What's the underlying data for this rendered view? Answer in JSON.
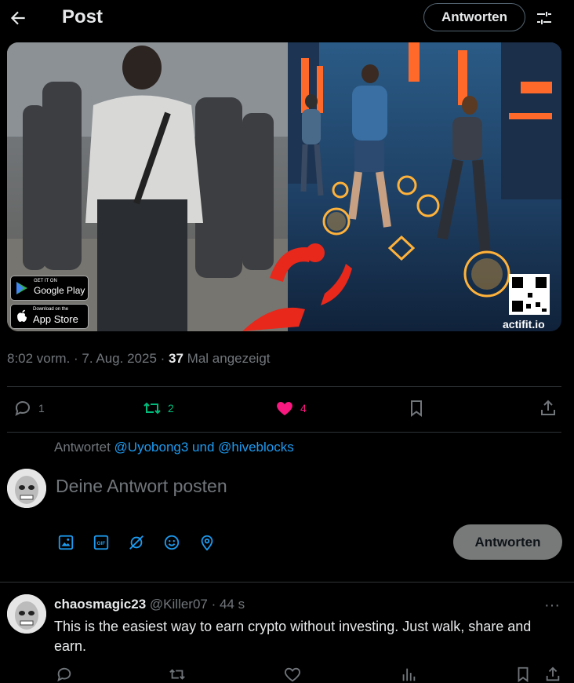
{
  "header": {
    "title": "Post",
    "reply_button": "Antworten"
  },
  "media": {
    "google_play_small": "GET IT ON",
    "google_play": "Google Play",
    "app_store_small": "Download on the",
    "app_store": "App Store",
    "watermark": "actifit.io"
  },
  "post": {
    "time": "8:02 vorm. · 7. Aug. 2025 ·",
    "views_count": "37",
    "views_label": "Mal angezeigt"
  },
  "actions": {
    "replies": "1",
    "reposts": "2",
    "likes": "4",
    "colors": {
      "repost": "#00ba7c",
      "like": "#f91880",
      "icon": "#71767b"
    }
  },
  "compose": {
    "replying_prefix": "Antwortet",
    "replying_users": "@Uyobong3 und @hiveblocks",
    "placeholder": "Deine Antwort posten",
    "submit": "Antworten"
  },
  "reply": {
    "name": "chaosmagic23",
    "meta": "@Killer07 · 44 s",
    "text": "This is the easiest way to earn crypto without investing. Just walk, share and earn.",
    "more": "···"
  }
}
